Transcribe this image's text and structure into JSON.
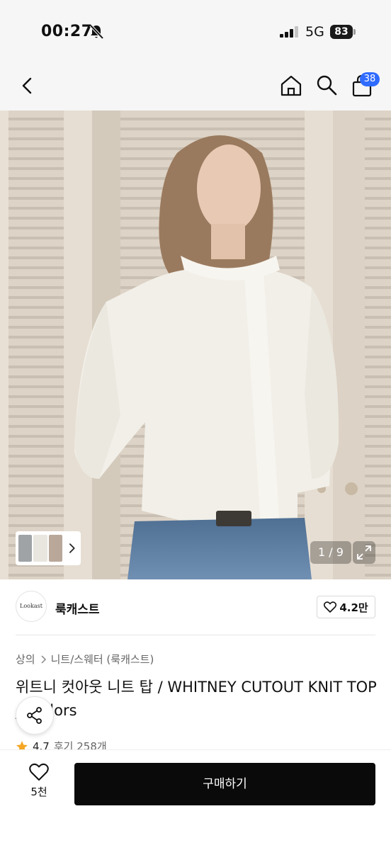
{
  "status_bar": {
    "time": "00:27",
    "network": "5G",
    "battery": "83",
    "icons": [
      "bell-off-icon",
      "signal-icon",
      "battery-icon"
    ]
  },
  "header": {
    "icons": [
      "chevron-left-icon",
      "home-icon",
      "search-icon",
      "cart-icon"
    ],
    "cart_count": "38"
  },
  "gallery": {
    "counter": "1 / 9",
    "icons": [
      "chevron-right-icon",
      "expand-icon"
    ]
  },
  "shop": {
    "logo_text": "Lookast",
    "name": "룩캐스트",
    "likes": "4.2만"
  },
  "product": {
    "breadcrumb": [
      "상의",
      "니트/스웨터 (룩캐스트)"
    ],
    "title": "위트니 컷아웃 니트 탑 / WHITNEY CUTOUT KNIT TOP_3colors",
    "rating": "4.7",
    "reviews": "후기 258개"
  },
  "bottom_bar": {
    "wish_count": "5천",
    "buy_label": "구매하기"
  },
  "colors": {
    "accent_blue": "#2f6bff",
    "star": "#f5a623",
    "buy_button": "#0a0a0a"
  }
}
